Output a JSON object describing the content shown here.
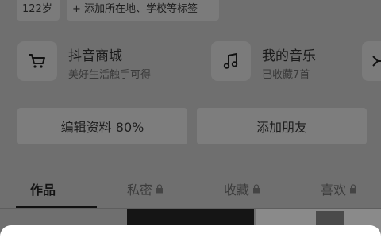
{
  "profile": {
    "age_tag": "122岁",
    "add_tag": "+ 添加所在地、学校等标签"
  },
  "features": {
    "shop": {
      "title": "抖音商城",
      "subtitle": "美好生活触手可得",
      "icon": "shopping-cart-icon"
    },
    "music": {
      "title": "我的音乐",
      "subtitle": "已收藏7首",
      "icon": "music-note-icon"
    },
    "extra": {
      "icon": "partial-feature-icon"
    }
  },
  "buttons": {
    "edit_profile": "编辑资料 80%",
    "add_friend": "添加朋友"
  },
  "tabs": [
    {
      "label": "作品",
      "locked": false,
      "active": true
    },
    {
      "label": "私密",
      "locked": true,
      "active": false
    },
    {
      "label": "收藏",
      "locked": true,
      "active": false
    },
    {
      "label": "喜欢",
      "locked": true,
      "active": false
    }
  ],
  "colors": {
    "overlay": "#6f6f6f",
    "card": "#7b7b7b",
    "sheet": "#ffffff"
  }
}
